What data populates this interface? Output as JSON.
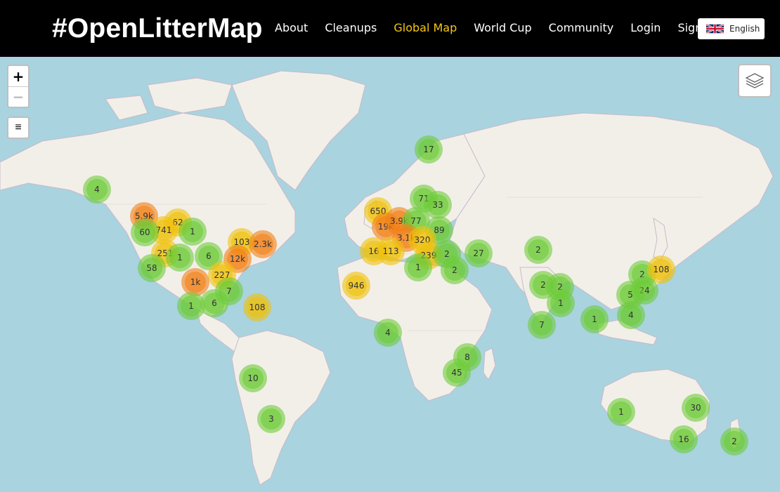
{
  "brand": "#OpenLitterMap",
  "nav": {
    "links": [
      {
        "label": "About",
        "active": false
      },
      {
        "label": "Cleanups",
        "active": false
      },
      {
        "label": "Global Map",
        "active": true
      },
      {
        "label": "World Cup",
        "active": false
      },
      {
        "label": "Community",
        "active": false
      },
      {
        "label": "Login",
        "active": false
      },
      {
        "label": "Signup",
        "active": false
      }
    ],
    "language": "English"
  },
  "map": {
    "zoom_in": "+",
    "zoom_out": "−",
    "menu_icon": "≡",
    "clusters": [
      {
        "count": "17"
      },
      {
        "count": "4"
      },
      {
        "count": "5.9k"
      },
      {
        "count": "62"
      },
      {
        "count": "741"
      },
      {
        "count": "60"
      },
      {
        "count": "1"
      },
      {
        "count": "251"
      },
      {
        "count": "1"
      },
      {
        "count": "58"
      },
      {
        "count": "6"
      },
      {
        "count": "103"
      },
      {
        "count": "2.3k"
      },
      {
        "count": "12k"
      },
      {
        "count": "227"
      },
      {
        "count": "1k"
      },
      {
        "count": "7"
      },
      {
        "count": "6"
      },
      {
        "count": "1"
      },
      {
        "count": "108"
      },
      {
        "count": "650"
      },
      {
        "count": "19k"
      },
      {
        "count": "3.9k"
      },
      {
        "count": "71"
      },
      {
        "count": "33"
      },
      {
        "count": "77"
      },
      {
        "count": "89"
      },
      {
        "count": "3.1k"
      },
      {
        "count": "320"
      },
      {
        "count": "16"
      },
      {
        "count": "113"
      },
      {
        "count": "239"
      },
      {
        "count": "2"
      },
      {
        "count": "1"
      },
      {
        "count": "2"
      },
      {
        "count": "27"
      },
      {
        "count": "946"
      },
      {
        "count": "2"
      },
      {
        "count": "2"
      },
      {
        "count": "2"
      },
      {
        "count": "2"
      },
      {
        "count": "108"
      },
      {
        "count": "24"
      },
      {
        "count": "5"
      },
      {
        "count": "7"
      },
      {
        "count": "1"
      },
      {
        "count": "1"
      },
      {
        "count": "4"
      },
      {
        "count": "8"
      },
      {
        "count": "45"
      },
      {
        "count": "10"
      },
      {
        "count": "3"
      },
      {
        "count": "1"
      },
      {
        "count": "30"
      },
      {
        "count": "16"
      },
      {
        "count": "2"
      }
    ]
  },
  "colors": {
    "small": "#6ecc39",
    "medium": "#f0c20c",
    "large": "#f18017",
    "active_link": "#f5c518",
    "ocean": "#a9d3df",
    "land": "#f2efe9"
  }
}
